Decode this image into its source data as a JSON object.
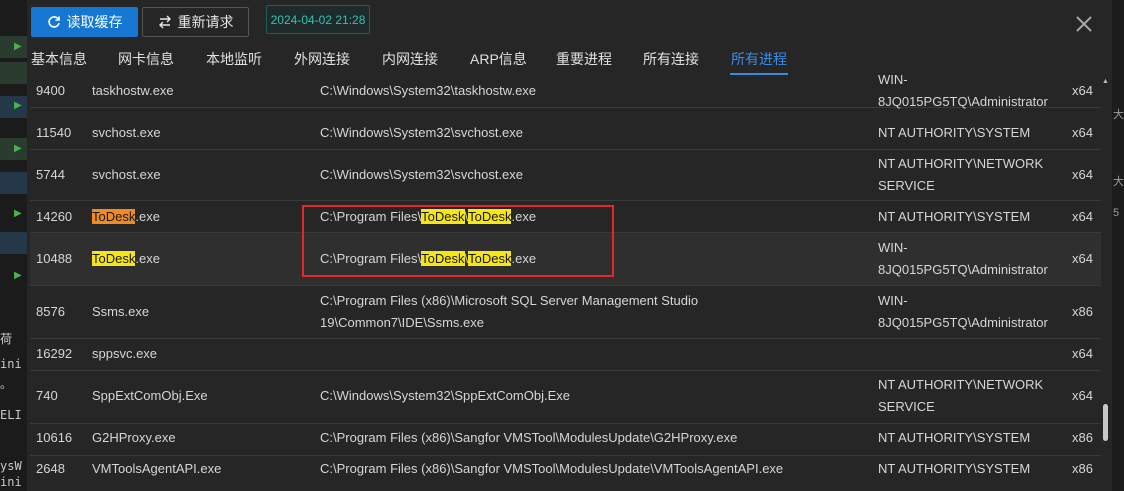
{
  "toolbar": {
    "read_cache_label": "读取缓存",
    "re_request_label": "重新请求",
    "timestamp": "2024-04-02 21:28"
  },
  "tabs": [
    {
      "label": "基本信息",
      "active": false
    },
    {
      "label": "网卡信息",
      "active": false
    },
    {
      "label": "本地监听",
      "active": false
    },
    {
      "label": "外网连接",
      "active": false
    },
    {
      "label": "内网连接",
      "active": false
    },
    {
      "label": "ARP信息",
      "active": false
    },
    {
      "label": "重要进程",
      "active": false
    },
    {
      "label": "所有连接",
      "active": false
    },
    {
      "label": "所有进程",
      "active": true
    }
  ],
  "rows": [
    {
      "pid": "9400",
      "name": "taskhostw.exe",
      "path": "C:\\Windows\\System32\\taskhostw.exe",
      "user1": "WIN-",
      "user2": "8JQ015PG5TQ\\Administrator",
      "arch": "x64"
    },
    {
      "pid": "11540",
      "name": "svchost.exe",
      "path": "C:\\Windows\\System32\\svchost.exe",
      "user1": "NT AUTHORITY\\SYSTEM",
      "user2": "",
      "arch": "x64"
    },
    {
      "pid": "5744",
      "name": "svchost.exe",
      "path": "C:\\Windows\\System32\\svchost.exe",
      "user1": "NT AUTHORITY\\NETWORK",
      "user2": "SERVICE",
      "arch": "x64"
    },
    {
      "pid": "14260",
      "name_hl": "ToDesk",
      "name_rest": ".exe",
      "path_a": "C:\\Program Files\\",
      "path_hl1": "ToDesk",
      "path_b": "\\",
      "path_hl2": "ToDesk",
      "path_c": ".exe",
      "user1": "NT AUTHORITY\\SYSTEM",
      "user2": "",
      "arch": "x64"
    },
    {
      "pid": "10488",
      "name_hl": "ToDesk",
      "name_rest": ".exe",
      "path_a": "C:\\Program Files\\",
      "path_hl1": "ToDesk",
      "path_b": "\\",
      "path_hl2": "ToDesk",
      "path_c": ".exe",
      "user1": "WIN-",
      "user2": "8JQ015PG5TQ\\Administrator",
      "arch": "x64"
    },
    {
      "pid": "8576",
      "name": "Ssms.exe",
      "path": "C:\\Program Files (x86)\\Microsoft SQL Server Management Studio",
      "path2": "19\\Common7\\IDE\\Ssms.exe",
      "user1": "WIN-",
      "user2": "8JQ015PG5TQ\\Administrator",
      "arch": "x86"
    },
    {
      "pid": "16292",
      "name": "sppsvc.exe",
      "path": "",
      "user1": "",
      "user2": "",
      "arch": "x64"
    },
    {
      "pid": "740",
      "name": "SppExtComObj.Exe",
      "path": "C:\\Windows\\System32\\SppExtComObj.Exe",
      "user1": "NT AUTHORITY\\NETWORK",
      "user2": "SERVICE",
      "arch": "x64"
    },
    {
      "pid": "10616",
      "name": "G2HProxy.exe",
      "path": "C:\\Program Files (x86)\\Sangfor VMSTool\\ModulesUpdate\\G2HProxy.exe",
      "user1": "NT AUTHORITY\\SYSTEM",
      "user2": "",
      "arch": "x86"
    },
    {
      "pid": "2648",
      "name": "VMToolsAgentAPI.exe",
      "path": "C:\\Program Files (x86)\\Sangfor VMSTool\\ModulesUpdate\\VMToolsAgentAPI.exe",
      "user1": "NT AUTHORITY\\SYSTEM",
      "user2": "",
      "arch": "x86"
    }
  ],
  "background": {
    "left_text": [
      "荷",
      "ini",
      "。",
      "ELI",
      "ysW",
      "ini"
    ],
    "right_text": [
      "大",
      "大",
      "5"
    ]
  },
  "colors": {
    "primary": "#1677d2",
    "active_tab": "#3b8be6",
    "highlight_yellow": "#f5e614",
    "highlight_orange": "#f08a24",
    "annotation_red": "#e02a2a",
    "timestamp": "#35c2b3"
  }
}
